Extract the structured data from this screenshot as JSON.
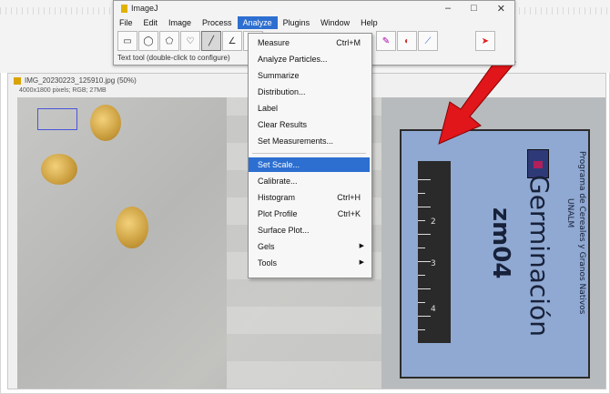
{
  "imagej": {
    "title": "ImageJ",
    "window_buttons": [
      "–",
      "□",
      "✕"
    ],
    "menus": [
      "File",
      "Edit",
      "Image",
      "Process",
      "Analyze",
      "Plugins",
      "Window",
      "Help"
    ],
    "active_menu": "Analyze",
    "status_text": "Text tool (double-click to configure)"
  },
  "image_window": {
    "title": "IMG_20230223_125910.jpg (50%)",
    "info": "4000x1800 pixels; RGB; 27MB"
  },
  "analyze_menu": {
    "items": [
      {
        "label": "Measure",
        "shortcut": "Ctrl+M"
      },
      {
        "label": "Analyze Particles..."
      },
      {
        "label": "Summarize"
      },
      {
        "label": "Distribution..."
      },
      {
        "label": "Label"
      },
      {
        "label": "Clear Results"
      },
      {
        "label": "Set Measurements..."
      },
      {
        "label": "Set Scale...",
        "highlighted": true
      },
      {
        "label": "Calibrate..."
      },
      {
        "label": "Histogram",
        "shortcut": "Ctrl+H"
      },
      {
        "label": "Plot Profile",
        "shortcut": "Ctrl+K"
      },
      {
        "label": "Surface Plot..."
      },
      {
        "label": "Gels",
        "submenu": true
      },
      {
        "label": "Tools",
        "submenu": true
      }
    ]
  },
  "photo_label": {
    "title": "Germinación",
    "code": "zm04",
    "org_line1": "Programa de Cereales y Granos Nativos",
    "org_line2": "UNALM",
    "ruler_numbers": [
      "2",
      "3",
      "4"
    ]
  },
  "colors": {
    "menu_highlight": "#2d6fd0",
    "arrow": "#e0161a",
    "label_card": "#8fa9d2"
  }
}
